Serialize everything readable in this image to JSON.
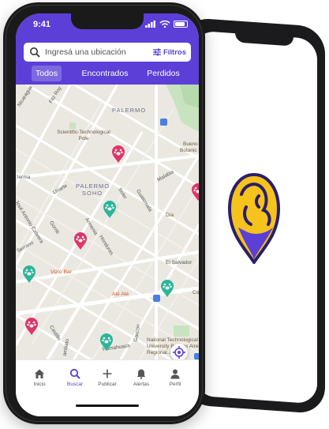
{
  "status_bar": {
    "time": "9:41"
  },
  "search": {
    "placeholder": "Ingresá una ubicación",
    "filters_label": "Filtros"
  },
  "tabs": [
    {
      "label": "Todos",
      "active": true
    },
    {
      "label": "Encontrados",
      "active": false
    },
    {
      "label": "Perdidos",
      "active": false
    }
  ],
  "map": {
    "districts": {
      "palermo": "PALERMO",
      "palermo_soho_1": "PALERMO",
      "palermo_soho_2": "SOHO"
    },
    "streets": {
      "fitz_roy": "Fitz Roy",
      "nicaragua": "Nicaragua",
      "soler": "Soler",
      "guatemala": "Guatemala",
      "malabia": "Malabia",
      "uriarte": "Uriarte",
      "gorriti": "Gorriti",
      "jose_antonio_cabrera": "José Antonio Cabrera",
      "armenia": "Armenia",
      "honduras": "Honduras",
      "serrano": "Serrano",
      "el_salvador": "El Salvador",
      "castillo": "Castillo",
      "gascon": "Gascón",
      "humahuaca": "Humahuaca",
      "lerma": "lerma",
      "ambato": "ambato"
    },
    "places": {
      "scientific_pole": "Scientific-Technological Pole",
      "buenos_aires_botanical_1": "Bueno",
      "buenos_aires_botanical_2": "Botanic",
      "dia": "Día",
      "vizio_bar": "Vizio Bar",
      "ale_ale": "Alé Alé",
      "utn": "National Technological University Buenos Aires Regional...",
      "coto_partial": "Co"
    },
    "pins": [
      {
        "type": "perdido",
        "color": "#e0356a"
      },
      {
        "type": "encontrado",
        "color": "#2bb59a"
      },
      {
        "type": "perdido",
        "color": "#e0356a"
      },
      {
        "type": "encontrado",
        "color": "#2bb59a"
      },
      {
        "type": "encontrado",
        "color": "#2bb59a"
      },
      {
        "type": "perdido",
        "color": "#e0356a"
      },
      {
        "type": "encontrado",
        "color": "#2bb59a"
      },
      {
        "type": "perdido",
        "color": "#e0356a"
      }
    ]
  },
  "nav": {
    "inicio": "Inicio",
    "buscar": "Buscar",
    "publicar": "Publicar",
    "alertas": "Alertas",
    "perfil": "Perfil"
  },
  "colors": {
    "accent": "#5b3fd6",
    "lost": "#e0356a",
    "found": "#2bb59a",
    "logo_yellow": "#f6c21c"
  }
}
